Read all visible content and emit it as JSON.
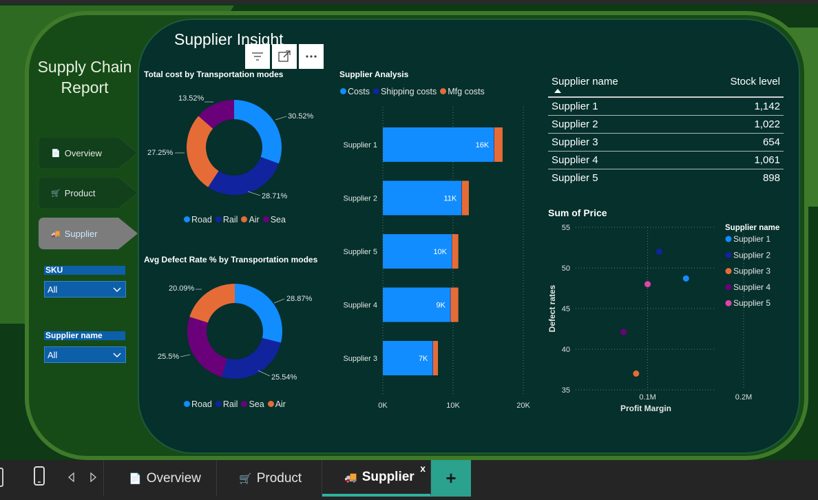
{
  "report": {
    "title_line1": "Supply Chain",
    "title_line2": "Report"
  },
  "page": {
    "title": "Supplier Insight"
  },
  "toolbar": {
    "filter_icon": "filter-icon",
    "focus_icon": "focus-mode-icon",
    "more_icon": "more-options-icon"
  },
  "nav": [
    {
      "label": "Overview",
      "icon": "document-icon",
      "active": false
    },
    {
      "label": "Product",
      "icon": "cart-icon",
      "active": false
    },
    {
      "label": "Supplier",
      "icon": "truck-icon",
      "active": true
    }
  ],
  "slicers": [
    {
      "title": "SKU",
      "value": "All"
    },
    {
      "title": "Supplier name",
      "value": "All"
    }
  ],
  "donut1": {
    "title": "Total cost by Transportation modes",
    "slices": [
      {
        "name": "Road",
        "value": 30.52,
        "label": "30.52%",
        "color": "#118dff"
      },
      {
        "name": "Rail",
        "value": 28.71,
        "label": "28.71%",
        "color": "#12239e"
      },
      {
        "name": "Air",
        "value": 27.25,
        "label": "27.25%",
        "color": "#e66c37"
      },
      {
        "name": "Sea",
        "value": 13.52,
        "label": "13.52%",
        "color": "#6b007b"
      }
    ],
    "legend": [
      "Road",
      "Rail",
      "Air",
      "Sea"
    ]
  },
  "donut2": {
    "title": "Avg Defect Rate % by Transportation modes",
    "slices": [
      {
        "name": "Road",
        "value": 28.87,
        "label": "28.87%",
        "color": "#118dff"
      },
      {
        "name": "Rail",
        "value": 25.54,
        "label": "25.54%",
        "color": "#12239e"
      },
      {
        "name": "Sea",
        "value": 25.5,
        "label": "25.5%",
        "color": "#6b007b"
      },
      {
        "name": "Air",
        "value": 20.09,
        "label": "20.09%",
        "color": "#e66c37"
      }
    ],
    "legend": [
      "Road",
      "Rail",
      "Sea",
      "Air"
    ]
  },
  "chart_data": [
    {
      "type": "bar",
      "orientation": "horizontal",
      "stacked": true,
      "title": "Supplier Analysis",
      "legend": [
        "Costs",
        "Shipping costs",
        "Mfg costs"
      ],
      "legend_colors": [
        "#118dff",
        "#12239e",
        "#e66c37"
      ],
      "categories": [
        "Supplier 1",
        "Supplier 2",
        "Supplier 5",
        "Supplier 4",
        "Supplier 3"
      ],
      "series": [
        {
          "name": "Costs",
          "values": [
            15800,
            11200,
            9800,
            9600,
            7100
          ],
          "data_labels": [
            "16K",
            "11K",
            "10K",
            "9K",
            "7K"
          ]
        },
        {
          "name": "Shipping costs",
          "values": [
            50,
            50,
            50,
            50,
            50
          ]
        },
        {
          "name": "Mfg costs",
          "values": [
            1200,
            1000,
            900,
            1100,
            700
          ]
        }
      ],
      "xticks": [
        "0K",
        "10K",
        "20K"
      ],
      "xlim": [
        0,
        20000
      ]
    },
    {
      "type": "scatter",
      "title": "Sum of Price",
      "xlabel": "Profit Margin",
      "ylabel": "Defect rates",
      "legend_title": "Supplier name",
      "xticks": [
        "0.1M",
        "0.2M"
      ],
      "xlim": [
        0.025,
        0.2
      ],
      "yticks": [
        "35",
        "40",
        "45",
        "50",
        "55"
      ],
      "ylim": [
        35,
        55
      ],
      "points": [
        {
          "name": "Supplier 1",
          "x": 0.14,
          "y": 48.7,
          "color": "#118dff"
        },
        {
          "name": "Supplier 2",
          "x": 0.112,
          "y": 52,
          "color": "#12239e"
        },
        {
          "name": "Supplier 3",
          "x": 0.088,
          "y": 37,
          "color": "#e66c37"
        },
        {
          "name": "Supplier 4",
          "x": 0.075,
          "y": 42.1,
          "color": "#6b007b"
        },
        {
          "name": "Supplier 5",
          "x": 0.1,
          "y": 48,
          "color": "#e044a7"
        }
      ]
    }
  ],
  "table": {
    "columns": [
      "Supplier name",
      "Stock level"
    ],
    "rows": [
      [
        "Supplier 1",
        "1,142"
      ],
      [
        "Supplier 2",
        "1,022"
      ],
      [
        "Supplier 3",
        "654"
      ],
      [
        "Supplier 4",
        "1,061"
      ],
      [
        "Supplier 5",
        "898"
      ]
    ]
  },
  "taskbar": {
    "tabs": [
      "Overview",
      "Product",
      "Supplier"
    ],
    "active": "Supplier",
    "close_label": "x",
    "add_label": "+"
  }
}
